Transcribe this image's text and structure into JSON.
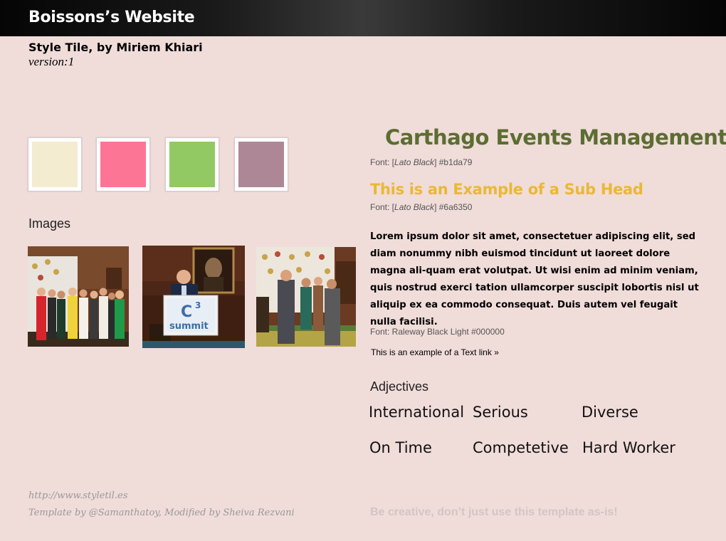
{
  "header": {
    "site_title": "Boissons’s Website"
  },
  "meta": {
    "tile_title": "Style Tile, by Miriem Khiari",
    "version": "version:1"
  },
  "palette": {
    "swatches": [
      "#f4ecd0",
      "#fd7595",
      "#93c963",
      "#ad8796"
    ]
  },
  "images": {
    "label": "Images",
    "photos": [
      {
        "subject": "group-photo-icon"
      },
      {
        "subject": "podium-speaker-icon"
      },
      {
        "subject": "event-crowd-icon"
      }
    ],
    "podium_text_line1": "C",
    "podium_text_sup": "3",
    "podium_text_line2": "summit"
  },
  "typography": {
    "heading": "Carthago Events Management",
    "heading_color": "#5b6e31",
    "heading_note_prefix": "Font: [",
    "heading_note_font": "Lato Black",
    "heading_note_suffix": "]  #b1da79",
    "subhead": "This is an Example of a Sub Head",
    "subhead_color": "#e9b934",
    "subhead_note_prefix": "Font: [",
    "subhead_note_font": "Lato Black",
    "subhead_note_suffix": "]  #6a6350",
    "body": "Lorem ipsum dolor sit amet, consectetuer adipiscing elit, sed diam nonummy nibh euismod tincidunt ut laoreet dolore magna ali-quam erat volutpat. Ut wisi enim ad minim veniam, quis nostrud exerci tation ullamcorper suscipit lobortis nisl ut aliquip ex ea commodo consequat. Duis autem vel feugait nulla facilisi.",
    "body_note": "Font: Raleway Black Light #000000",
    "text_link": "This is an example of a Text link »"
  },
  "adjectives": {
    "label": "Adjectives",
    "items": [
      "International",
      "Serious",
      "Diverse",
      "On Time",
      "Competetive",
      "Hard Worker"
    ]
  },
  "footer": {
    "url": "http://www.styletil.es",
    "credit": "Template by @Samanthatoy, Modified by Sheiva Rezvani",
    "tagline": "Be creative, don’t just use this template as-is!"
  }
}
